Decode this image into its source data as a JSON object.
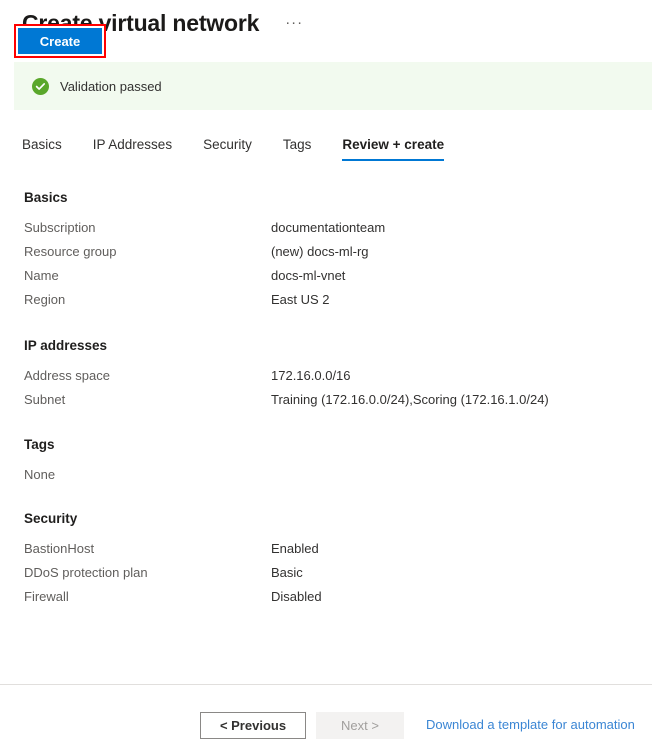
{
  "header": {
    "title": "Create virtual network",
    "more_label": "···"
  },
  "banner": {
    "icon": "check-circle-icon",
    "text": "Validation passed",
    "background": "#f2faef",
    "icon_color": "#5aa72b"
  },
  "tabs": [
    {
      "label": "Basics",
      "selected": false
    },
    {
      "label": "IP Addresses",
      "selected": false
    },
    {
      "label": "Security",
      "selected": false
    },
    {
      "label": "Tags",
      "selected": false
    },
    {
      "label": "Review + create",
      "selected": true
    }
  ],
  "tab_accent": "#0078d4",
  "sections": {
    "basics": {
      "heading": "Basics",
      "rows": [
        {
          "label": "Subscription",
          "value": "documentationteam"
        },
        {
          "label": "Resource group",
          "value": "(new) docs-ml-rg"
        },
        {
          "label": "Name",
          "value": "docs-ml-vnet"
        },
        {
          "label": "Region",
          "value": "East US 2"
        }
      ]
    },
    "ip_addresses": {
      "heading": "IP addresses",
      "rows": [
        {
          "label": "Address space",
          "value": "172.16.0.0/16"
        },
        {
          "label": "Subnet",
          "value": "Training (172.16.0.0/24),Scoring (172.16.1.0/24)"
        }
      ]
    },
    "tags": {
      "heading": "Tags",
      "value": "None"
    },
    "security": {
      "heading": "Security",
      "rows": [
        {
          "label": "BastionHost",
          "value": "Enabled"
        },
        {
          "label": "DDoS protection plan",
          "value": "Basic"
        },
        {
          "label": "Firewall",
          "value": "Disabled"
        }
      ]
    }
  },
  "footer": {
    "create_label": "Create",
    "previous_label": "< Previous",
    "next_label": "Next >",
    "download_label": "Download a template for automation",
    "create_color": "#0078d4",
    "highlight_color": "#ff0000",
    "link_color": "#3b86d4"
  }
}
